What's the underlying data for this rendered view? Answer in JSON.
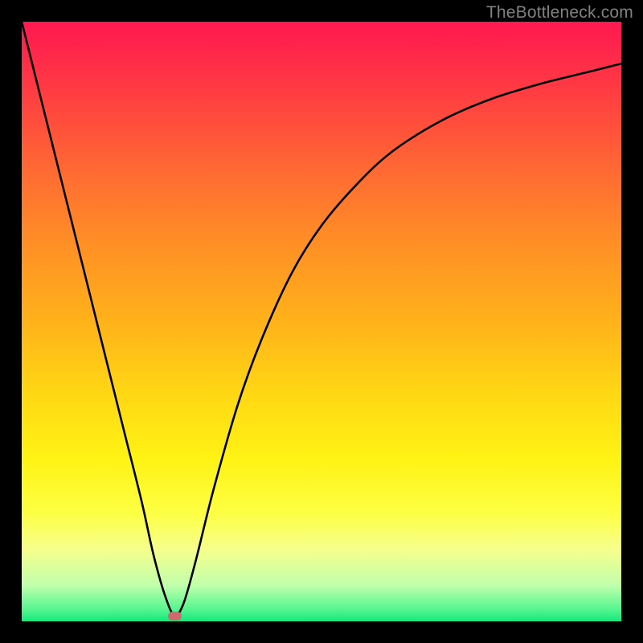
{
  "watermark": "TheBottleneck.com",
  "chart_data": {
    "type": "line",
    "title": "",
    "xlabel": "",
    "ylabel": "",
    "xlim": [
      0,
      100
    ],
    "ylim": [
      0,
      100
    ],
    "x": [
      0,
      2,
      5,
      8,
      11,
      14,
      17,
      20,
      22,
      24,
      25.5,
      27,
      29,
      32,
      36,
      40,
      45,
      50,
      56,
      62,
      70,
      78,
      86,
      94,
      100
    ],
    "y": [
      100,
      92,
      80,
      68,
      56,
      44,
      32,
      20,
      11,
      4,
      1,
      3,
      10,
      22,
      36,
      47,
      58,
      66,
      73,
      78.5,
      83.5,
      87,
      89.5,
      91.5,
      93
    ],
    "marker": {
      "x": 25.5,
      "y": 1
    },
    "colors": {
      "curve": "#000000",
      "marker": "#ce6a6e",
      "gradient_top": "#ff1850",
      "gradient_bottom": "#14e87c"
    }
  }
}
